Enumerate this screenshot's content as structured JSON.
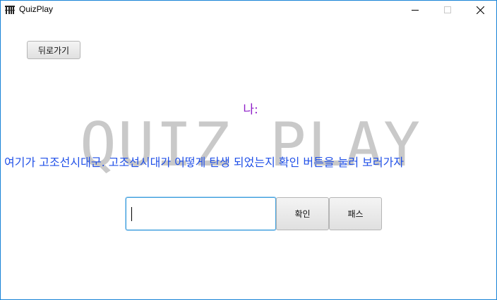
{
  "window": {
    "title": "QuizPlay"
  },
  "toolbar": {
    "back_label": "뒤로가기"
  },
  "watermark": {
    "text": "QUIZ PLAY"
  },
  "dialog": {
    "speaker": "나:",
    "text": "여기가 고조선시대군. 고조선시대가 어떻게 탄생 되었는지 확인 버튼을 눌러 보러가자"
  },
  "answer": {
    "value": ""
  },
  "actions": {
    "confirm_label": "확인",
    "pass_label": "패스"
  },
  "colors": {
    "speaker": "#8e1cc8",
    "dialog_text": "#2050e8",
    "watermark": "#c9c9c9",
    "input_focus": "#3e9fdc"
  }
}
